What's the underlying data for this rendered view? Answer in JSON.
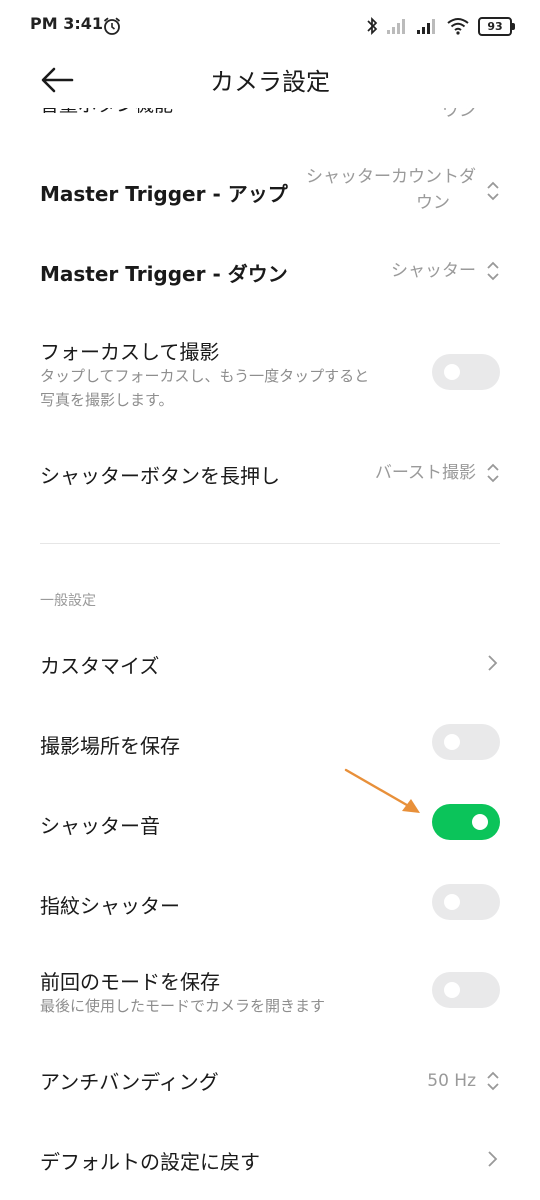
{
  "status_bar": {
    "time": "PM 3:41",
    "battery": "93",
    "icons": [
      "alarm-icon",
      "bluetooth-icon",
      "signal-icon",
      "signal-icon",
      "wifi-icon",
      "battery-icon"
    ]
  },
  "header": {
    "title": "カメラ設定",
    "back_icon": "arrow-left-icon"
  },
  "settings": {
    "clipped_row": {
      "label": "音量ボタン機能",
      "value": "ワン"
    },
    "master_up": {
      "label": "Master Trigger - アップ",
      "value_line1": "シャッターカウントダ",
      "value_line2": "ウン"
    },
    "master_down": {
      "label": "Master Trigger - ダウン",
      "value": "シャッター"
    },
    "focus_shoot": {
      "label": "フォーカスして撮影",
      "description_line1": "タップしてフォーカスし、もう一度タップすると",
      "description_line2": "写真を撮影します。",
      "enabled": false
    },
    "long_press": {
      "label": "シャッターボタンを長押し",
      "value": "バースト撮影"
    }
  },
  "general": {
    "section_title": "一般設定",
    "customize": {
      "label": "カスタマイズ"
    },
    "save_location": {
      "label": "撮影場所を保存",
      "enabled": false
    },
    "shutter_sound": {
      "label": "シャッター音",
      "enabled": true
    },
    "fingerprint_shutter": {
      "label": "指紋シャッター",
      "enabled": false
    },
    "save_mode": {
      "label": "前回のモードを保存",
      "description": "最後に使用したモードでカメラを開きます",
      "enabled": false
    },
    "anti_banding": {
      "label": "アンチバンディング",
      "value": "50 Hz"
    },
    "reset_defaults": {
      "label": "デフォルトの設定に戻す"
    }
  },
  "colors": {
    "toggle_on": "#0bc45a",
    "toggle_off": "#e9e9ea",
    "annotation_arrow": "#e8903a"
  }
}
